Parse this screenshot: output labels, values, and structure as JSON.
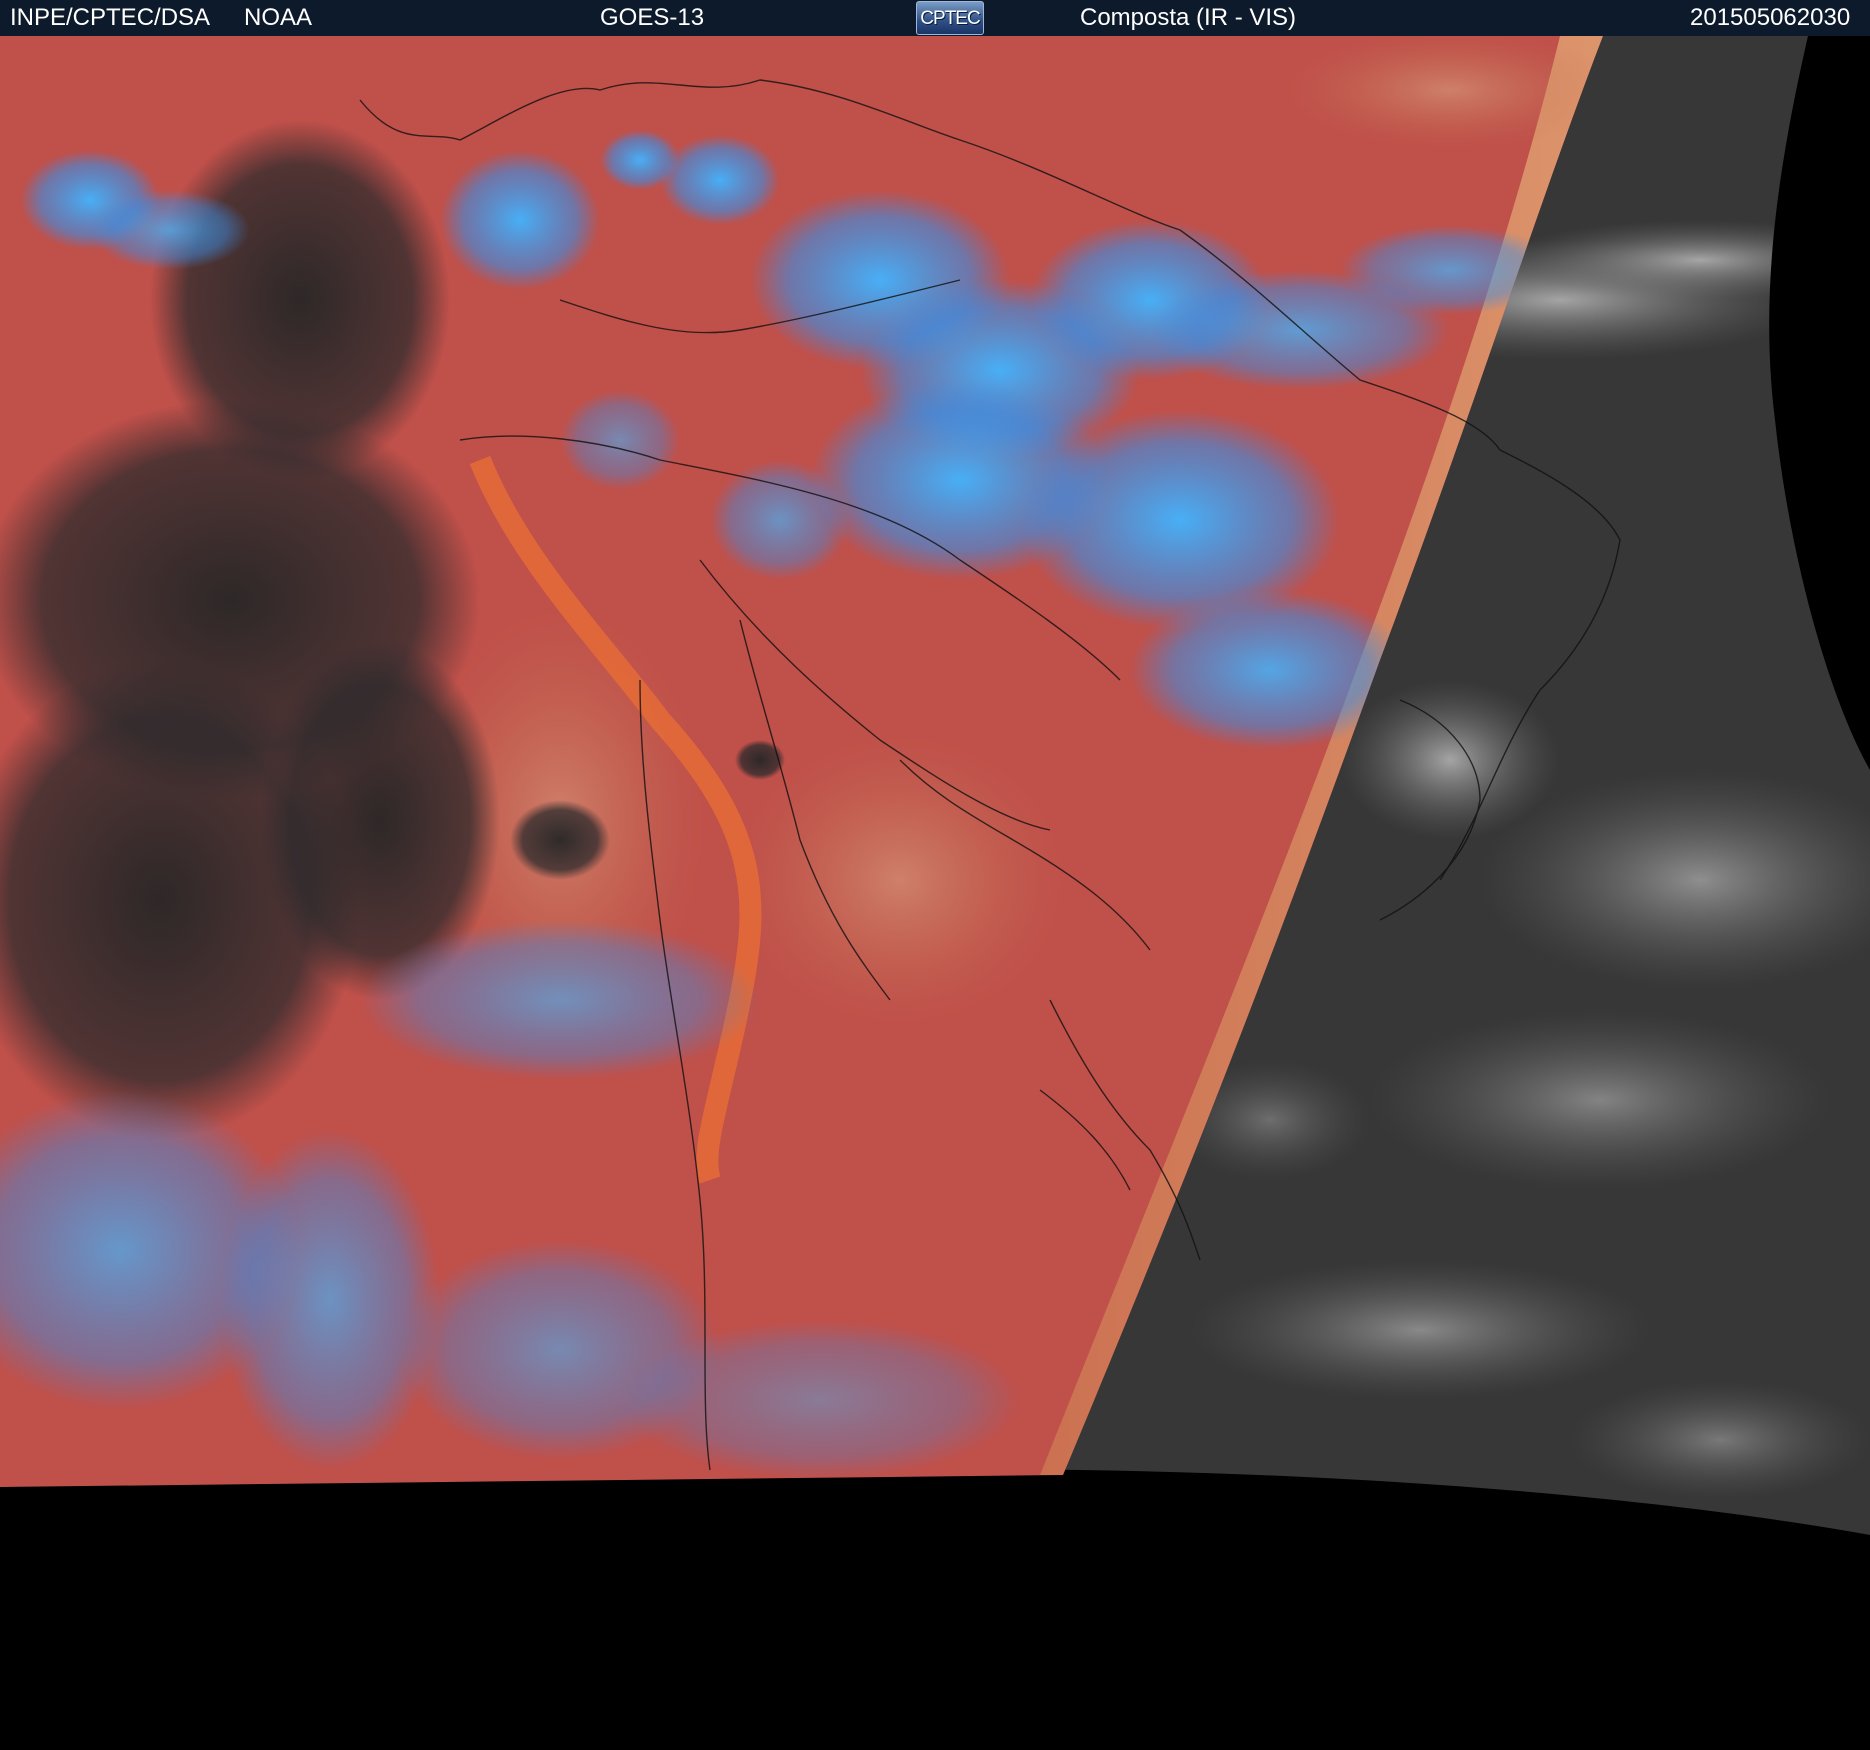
{
  "header": {
    "institution": "INPE/CPTEC/DSA",
    "agency": "NOAA",
    "satellite": "GOES-13",
    "logo_text": "CPTEC",
    "product": "Composta (IR - VIS)",
    "timestamp": "201505062030"
  },
  "colors": {
    "header_bg": "#0d1a2b",
    "header_text": "#ffffff",
    "composite_red": "#c0504a",
    "composite_orange": "#e07044",
    "composite_blue": "#3aa0ee",
    "composite_dark": "#2a2a2a",
    "vis_gray": "#3c3c3c",
    "space_black": "#000000"
  }
}
